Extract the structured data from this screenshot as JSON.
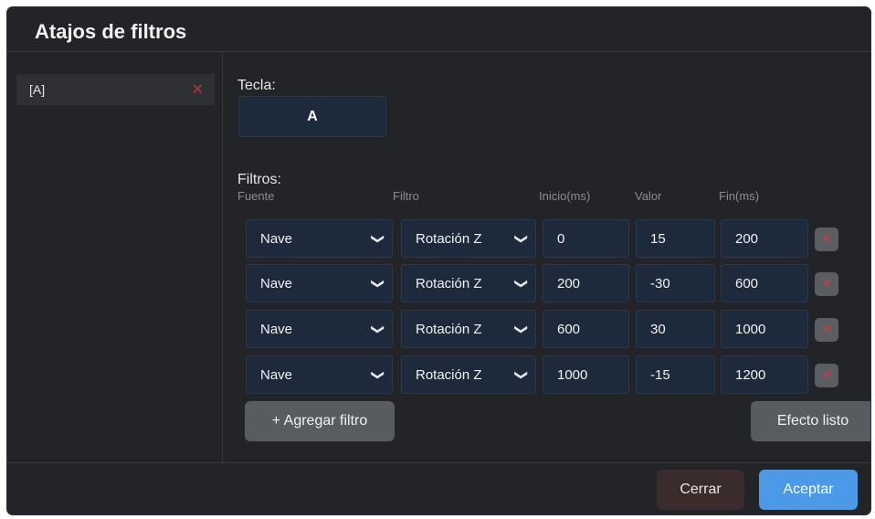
{
  "dialog": {
    "title": "Atajos de filtros"
  },
  "sidebar": {
    "items": [
      {
        "label": "[A]"
      }
    ]
  },
  "main": {
    "key_label": "Tecla:",
    "key_value": "A",
    "filters_label": "Filtros:",
    "columns": [
      "Fuente",
      "Filtro",
      "Inicio(ms)",
      "Valor",
      "Fin(ms)"
    ],
    "rows": [
      {
        "source": "Nave",
        "filter": "Rotación Z",
        "start": "0",
        "value": "15",
        "end": "200"
      },
      {
        "source": "Nave",
        "filter": "Rotación Z",
        "start": "200",
        "value": "-30",
        "end": "600"
      },
      {
        "source": "Nave",
        "filter": "Rotación Z",
        "start": "600",
        "value": "30",
        "end": "1000"
      },
      {
        "source": "Nave",
        "filter": "Rotación Z",
        "start": "1000",
        "value": "-15",
        "end": "1200"
      }
    ],
    "add_filter_label": "+ Agregar filtro",
    "effect_ready_label": "Efecto listo"
  },
  "footer": {
    "close_label": "Cerrar",
    "accept_label": "Aceptar"
  },
  "icons": {
    "delete": "close-icon",
    "select": "chevron-down-icon"
  },
  "colors": {
    "accent": "#4a9ae8",
    "danger": "#c0403f",
    "field_bg": "#1d2a3c"
  }
}
